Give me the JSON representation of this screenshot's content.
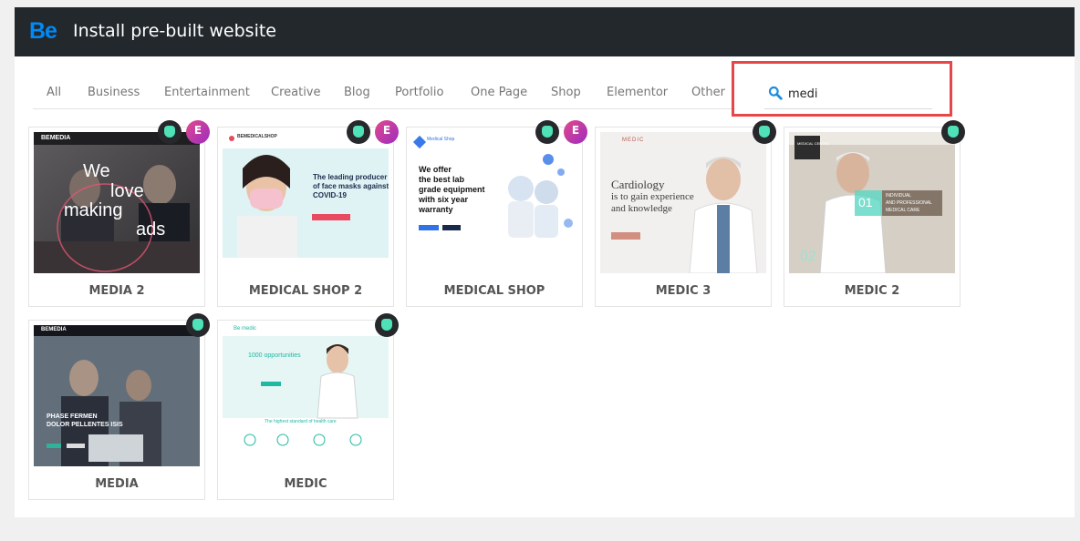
{
  "header": {
    "logo": "Be",
    "title": "Install pre-built website"
  },
  "tabs": [
    "All",
    "Business",
    "Entertainment",
    "Creative",
    "Blog",
    "Portfolio",
    "One Page",
    "Shop",
    "Elementor",
    "Other"
  ],
  "search": {
    "value": "medi"
  },
  "colors": {
    "accent": "#0089f7",
    "header_bg": "#23282d",
    "highlight": "#e8474a",
    "be_badge": "#4fe2b8"
  },
  "badges": {
    "elementor_glyph": "E"
  },
  "cards": [
    {
      "label": "MEDIA 2",
      "elementor": true,
      "thumb": {
        "nav_brand": "BEMEDIA",
        "headline": [
          "We",
          "love",
          "making",
          "ads"
        ]
      }
    },
    {
      "label": "MEDICAL SHOP 2",
      "elementor": true,
      "thumb": {
        "nav_brand": "BEMEDICALSHOP",
        "headline": [
          "The leading producer",
          "of face masks against",
          "COVID-19"
        ]
      }
    },
    {
      "label": "MEDICAL SHOP",
      "elementor": true,
      "thumb": {
        "nav_brand": "Medical Shop",
        "headline": [
          "We offer",
          "the best lab",
          "grade equipment",
          "with six year",
          "warranty"
        ]
      }
    },
    {
      "label": "MEDIC 3",
      "elementor": false,
      "thumb": {
        "nav_brand": "MEDIC",
        "headline": [
          "Cardiology",
          "is to gain experience",
          "and knowledge"
        ]
      }
    },
    {
      "label": "MEDIC 2",
      "elementor": false,
      "thumb": {
        "nav_brand": "MEDICAL CENTRE",
        "headline": [
          "INDIVIDUAL",
          "AND PROFESSIONAL",
          "MEDICAL CARE"
        ],
        "numbers": [
          "01",
          "02"
        ]
      }
    },
    {
      "label": "MEDIA",
      "elementor": false,
      "thumb": {
        "nav_brand": "BEMEDIA",
        "headline": [
          "PHASE FERMEN",
          "DOLOR PELLENTES ISIS"
        ]
      }
    },
    {
      "label": "MEDIC",
      "elementor": false,
      "thumb": {
        "nav_brand": "Be medic",
        "headline": [
          "1000 opportunities"
        ],
        "tagline": "The highest standard of health care"
      }
    }
  ]
}
